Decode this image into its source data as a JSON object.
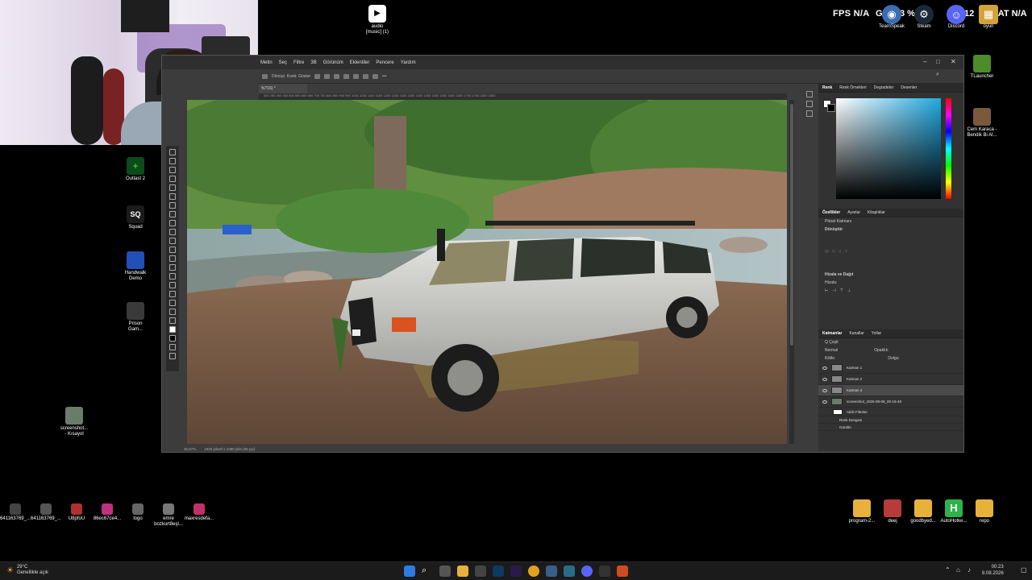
{
  "overlay": {
    "fps_label": "FPS",
    "fps_value": "N/A",
    "gpu_label": "GPU",
    "gpu_value": "13 %",
    "lat_label": "LAT",
    "lat_value": "N/A",
    "tray_apps": [
      {
        "label": "TeamSpeak",
        "color": "#3c6db0"
      },
      {
        "label": "Steam",
        "color": "#1b2838"
      },
      {
        "label": "Discord",
        "color": "#5865f2"
      },
      {
        "label": "oyun",
        "color": "#d3a33a"
      }
    ],
    "counter": "12"
  },
  "desktop": {
    "top_icon": {
      "label": "audio\n[music] (1)"
    },
    "left_icons": [
      {
        "label": "Outlast 2",
        "color": "#0c4b1a"
      },
      {
        "label": "Squad",
        "color": "#1b1b1b"
      },
      {
        "label": "Handwalk\nDemo",
        "color": "#2050b8"
      },
      {
        "label": "Prison\nGam...",
        "color": "#3a3a3a"
      },
      {
        "label": "screenshot...\n- Kısayol",
        "color": "#6a7c6a"
      }
    ],
    "right_icons": [
      {
        "label": "TLauncher",
        "color": "#4c8c2a"
      },
      {
        "label": "Cem Karaca -\nBendik Bi Al...",
        "color": "#7a5a3a"
      }
    ],
    "bottom_left_icons": [
      {
        "label": "641163769_...",
        "color": "#444"
      },
      {
        "label": "641163769_...",
        "color": "#555"
      },
      {
        "label": "U8pfoU",
        "color": "#b03030"
      },
      {
        "label": "86ec67ce4...",
        "color": "#c03080"
      },
      {
        "label": "logo",
        "color": "#666"
      },
      {
        "label": "emre\nbozkurt8eşl...",
        "color": "#777"
      },
      {
        "label": "maxresdefa...",
        "color": "#c0306a"
      }
    ],
    "bottom_right_icons": [
      {
        "label": "program-2...",
        "color": "#e8b23a"
      },
      {
        "label": "deej",
        "color": "#b83a3a"
      },
      {
        "label": "goodbyed...",
        "color": "#e8b23a"
      },
      {
        "label": "AutoHotke...",
        "color": "#2db34a"
      },
      {
        "label": "repo",
        "color": "#e8b23a"
      }
    ]
  },
  "photoshop": {
    "menu": [
      "Metin",
      "Seç",
      "Filtre",
      "3B",
      "Görünüm",
      "Eklentiler",
      "Pencere",
      "Yardım"
    ],
    "options_text": "Dönüşt. Kontr. Göster",
    "tab_title": "%?16) *",
    "ruler": "300  250  400  450  500  550  600  650  700  750  800  850  900  950  1000  1050  1100  1150  1200  1250  1300  1350  1400  1450  1500  1550  1600  1650  1700  1750  1800  1850",
    "status_zoom": "46,67%",
    "status_size": "1920 piksel x 1080 piks (96 ppi)",
    "panel_color_tabs": [
      "Renk",
      "Renk Örnekleri",
      "Degradeler",
      "Desenler"
    ],
    "panel_props_tabs": [
      "Özellikler",
      "Ayarlar",
      "Kitaplıklar"
    ],
    "props_pixel_layer": "Piksel Katmanı",
    "props_transform": "Dönüştür",
    "props_align": "Hizala ve Dağıt",
    "props_align_sub": "Hizala:",
    "panel_layers_tabs": [
      "Katmanlar",
      "Kanallar",
      "Yollar"
    ],
    "layers_kind": "Q Çeşit",
    "layers_blend": "Normal",
    "layers_opacity": "Opaklık:",
    "layers_lock": "Kilitle:",
    "layers_fill": "Dolgu:",
    "layers": [
      {
        "name": "Katman 1",
        "selected": false
      },
      {
        "name": "Katman 2",
        "selected": false
      },
      {
        "name": "Katman 3",
        "selected": true
      },
      {
        "name": "screenshot_2026-08-08_00-19-49",
        "selected": false
      },
      {
        "name": "Akıllı Filtreler",
        "selected": false
      },
      {
        "name": "Renk Dengesi",
        "selected": false
      },
      {
        "name": "Gürültü",
        "selected": false
      }
    ]
  },
  "taskbar": {
    "weather_temp": "29°C",
    "weather_desc": "Genellikle açık",
    "time": "00:23",
    "date": "8.08.2026"
  }
}
